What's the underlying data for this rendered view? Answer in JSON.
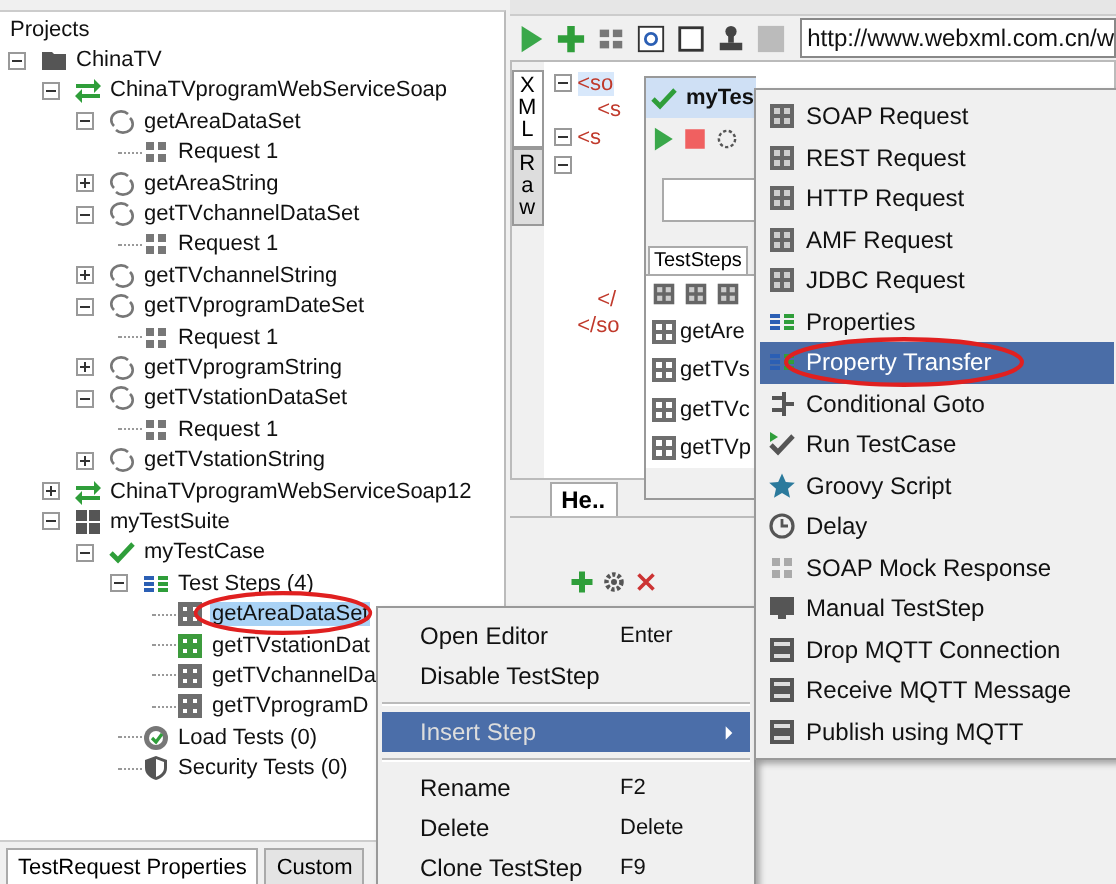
{
  "tree": {
    "title": "Projects",
    "items": [
      {
        "label": "ChinaTV",
        "kind": "folder",
        "expanded": true,
        "selected": false,
        "children": [
          {
            "label": "ChinaTVprogramWebServiceSoap",
            "kind": "interface",
            "expanded": true,
            "selected": false,
            "children": [
              {
                "label": "getAreaDataSet",
                "kind": "operation",
                "expanded": true,
                "selected": false,
                "children": [
                  {
                    "label": "Request 1",
                    "kind": "request",
                    "selected": false
                  }
                ]
              },
              {
                "label": "getAreaString",
                "kind": "operation",
                "expanded": false,
                "selected": false
              },
              {
                "label": "getTVchannelDataSet",
                "kind": "operation",
                "expanded": true,
                "selected": false,
                "children": [
                  {
                    "label": "Request 1",
                    "kind": "request",
                    "selected": false
                  }
                ]
              },
              {
                "label": "getTVchannelString",
                "kind": "operation",
                "expanded": false,
                "selected": false
              },
              {
                "label": "getTVprogramDateSet",
                "kind": "operation",
                "expanded": true,
                "selected": false,
                "children": [
                  {
                    "label": "Request 1",
                    "kind": "request",
                    "selected": false
                  }
                ]
              },
              {
                "label": "getTVprogramString",
                "kind": "operation",
                "expanded": false,
                "selected": false
              },
              {
                "label": "getTVstationDataSet",
                "kind": "operation",
                "expanded": true,
                "selected": false,
                "children": [
                  {
                    "label": "Request 1",
                    "kind": "request",
                    "selected": false
                  }
                ]
              },
              {
                "label": "getTVstationString",
                "kind": "operation",
                "expanded": false,
                "selected": false
              }
            ]
          },
          {
            "label": "ChinaTVprogramWebServiceSoap12",
            "kind": "interface",
            "expanded": false,
            "selected": false
          },
          {
            "label": "myTestSuite",
            "kind": "suite",
            "expanded": true,
            "selected": false,
            "children": [
              {
                "label": "myTestCase",
                "kind": "testcase",
                "expanded": true,
                "selected": false,
                "children": [
                  {
                    "label": "Test Steps (4)",
                    "kind": "steps",
                    "expanded": true,
                    "selected": false,
                    "children": [
                      {
                        "label": "getAreaDataSet",
                        "kind": "teststep",
                        "color": "#6e6e6e",
                        "selected": true
                      },
                      {
                        "label": "getTVstationDat",
                        "kind": "teststep",
                        "color": "#3d9b3d",
                        "selected": false
                      },
                      {
                        "label": "getTVchannelDa",
                        "kind": "teststep",
                        "color": "#6e6e6e",
                        "selected": false
                      },
                      {
                        "label": "getTVprogramD",
                        "kind": "teststep",
                        "color": "#6e6e6e",
                        "selected": false
                      }
                    ]
                  },
                  {
                    "label": "Load Tests (0)",
                    "kind": "loadtests",
                    "selected": false
                  },
                  {
                    "label": "Security Tests (0)",
                    "kind": "securitytests",
                    "selected": false
                  }
                ]
              }
            ]
          }
        ]
      }
    ]
  },
  "bottom_tabs": [
    {
      "label": "TestRequest Properties",
      "selected": true
    },
    {
      "label": "Custom",
      "selected": false
    }
  ],
  "endpoint": {
    "value": "http://www.webxml.com.cn/w"
  },
  "editor": {
    "side_tabs": [
      {
        "label": "XML",
        "selected": true
      },
      {
        "label": "Raw",
        "selected": false
      }
    ],
    "code_lines": [
      {
        "text": "<so",
        "expanded": true
      },
      {
        "text": "<s"
      },
      {
        "text": "<s",
        "expanded": true
      },
      {
        "expanded": true
      }
    ],
    "closing_lines": [
      {
        "text": "</"
      },
      {
        "text": "</so"
      }
    ]
  },
  "lower_tab": {
    "label": "He.."
  },
  "testcase_window": {
    "title": "myTes",
    "tab": "TestSteps",
    "steps": [
      "getAre",
      "getTVs",
      "getTVc",
      "getTVp"
    ]
  },
  "context_menu": [
    {
      "kind": "item",
      "label": "Open Editor",
      "shortcut": "Enter",
      "selected": false
    },
    {
      "kind": "item",
      "label": "Disable TestStep",
      "selected": false
    },
    {
      "kind": "separator"
    },
    {
      "kind": "item",
      "label": "Insert Step",
      "selected": true,
      "submenu": true
    },
    {
      "kind": "separator"
    },
    {
      "kind": "item",
      "label": "Rename",
      "shortcut": "F2",
      "selected": false
    },
    {
      "kind": "item",
      "label": "Delete",
      "shortcut": "Delete",
      "selected": false
    },
    {
      "kind": "item",
      "label": "Clone TestStep",
      "shortcut": "F9",
      "selected": false
    }
  ],
  "submenu": [
    {
      "kind": "request",
      "label": "SOAP Request",
      "selected": false
    },
    {
      "kind": "request",
      "label": "REST Request",
      "selected": false
    },
    {
      "kind": "request",
      "label": "HTTP Request",
      "selected": false
    },
    {
      "kind": "request",
      "label": "AMF Request",
      "selected": false
    },
    {
      "kind": "request",
      "label": "JDBC Request",
      "selected": false
    },
    {
      "kind": "properties",
      "label": "Properties",
      "selected": false
    },
    {
      "kind": "transfer",
      "label": "Property Transfer",
      "selected": true
    },
    {
      "kind": "goto",
      "label": "Conditional Goto",
      "selected": false
    },
    {
      "kind": "run",
      "label": "Run TestCase",
      "selected": false
    },
    {
      "kind": "script",
      "label": "Groovy Script",
      "selected": false
    },
    {
      "kind": "delay",
      "label": "Delay",
      "selected": false
    },
    {
      "kind": "mock",
      "label": "SOAP Mock Response",
      "selected": false
    },
    {
      "kind": "manual",
      "label": "Manual TestStep",
      "selected": false
    },
    {
      "kind": "mqtt",
      "label": "Drop MQTT Connection",
      "selected": false
    },
    {
      "kind": "mqtt",
      "label": "Receive MQTT Message",
      "selected": false
    },
    {
      "kind": "mqtt",
      "label": "Publish using MQTT",
      "selected": false
    }
  ]
}
